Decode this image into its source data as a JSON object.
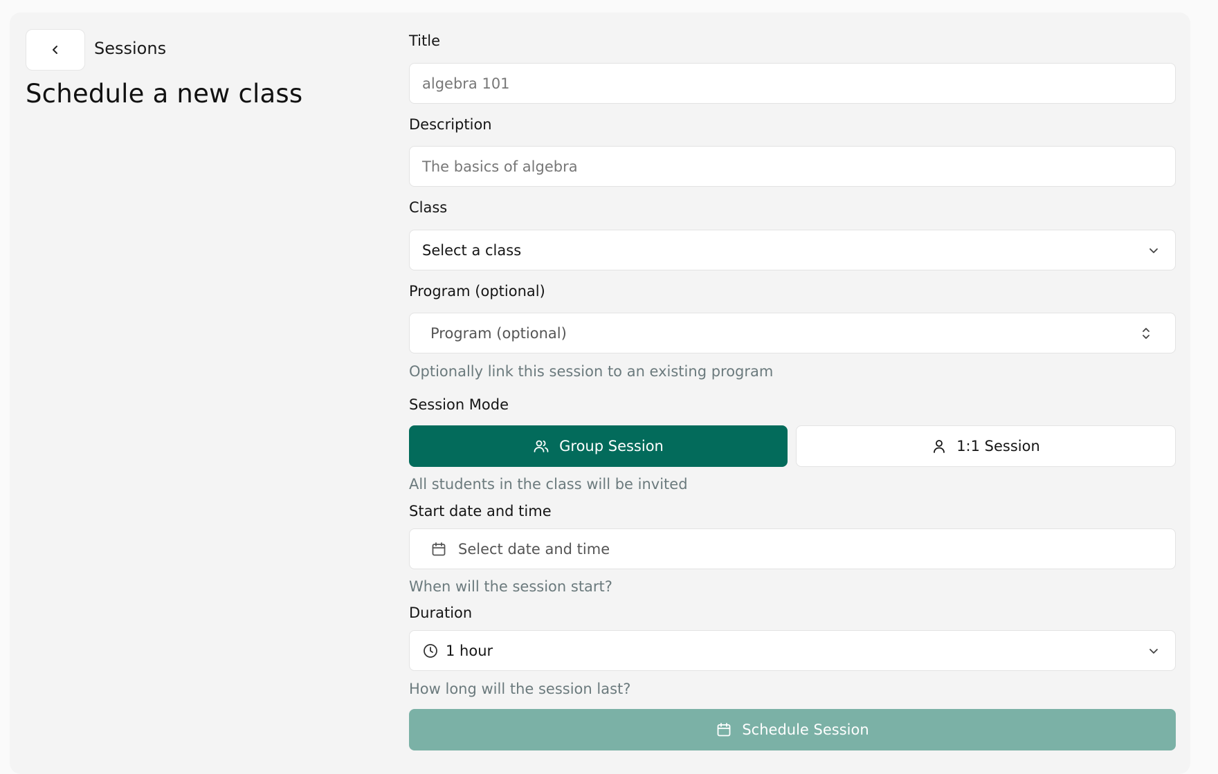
{
  "header": {
    "breadcrumb": "Sessions",
    "title": "Schedule a new class"
  },
  "form": {
    "title": {
      "label": "Title",
      "placeholder": "algebra 101"
    },
    "description": {
      "label": "Description",
      "placeholder": "The basics of algebra"
    },
    "class": {
      "label": "Class",
      "value": "Select a class"
    },
    "program": {
      "label": "Program (optional)",
      "placeholder": "Program (optional)",
      "help": "Optionally link this session to an existing program"
    },
    "session_mode": {
      "label": "Session Mode",
      "options": [
        {
          "label": "Group Session",
          "selected": true
        },
        {
          "label": "1:1 Session",
          "selected": false
        }
      ],
      "help": "All students in the class will be invited"
    },
    "start": {
      "label": "Start date and time",
      "placeholder": "Select date and time",
      "help": "When will the session start?"
    },
    "duration": {
      "label": "Duration",
      "value": "1 hour",
      "help": "How long will the session last?"
    },
    "submit_label": "Schedule Session"
  },
  "colors": {
    "primary": "#036b5b",
    "primary_disabled": "#7bb1a6",
    "panel_bg": "#f4f4f4"
  },
  "icons": [
    "chevron-left-icon",
    "chevron-down-icon",
    "chevron-up-down-icon",
    "users-icon",
    "user-icon",
    "calendar-icon",
    "clock-icon"
  ]
}
